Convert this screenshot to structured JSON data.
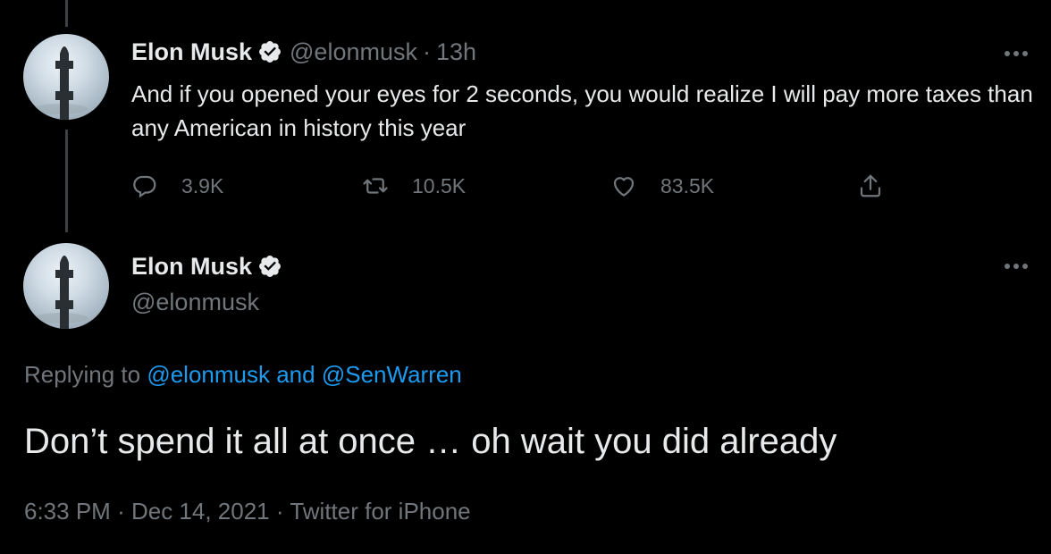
{
  "parent_tweet": {
    "display_name": "Elon Musk",
    "handle": "@elonmusk",
    "separator": "·",
    "time": "13h",
    "text": "And if you opened your eyes for 2 seconds, you would realize I will pay more taxes than any American in history this year",
    "actions": {
      "reply_count": "3.9K",
      "retweet_count": "10.5K",
      "like_count": "83.5K"
    },
    "icons": [
      "verified-badge-icon",
      "more-icon",
      "reply-icon",
      "retweet-icon",
      "like-icon",
      "share-icon"
    ]
  },
  "main_tweet": {
    "display_name": "Elon Musk",
    "handle": "@elonmusk",
    "replying_prefix": "Replying to",
    "replying_to_1": "@elonmusk",
    "replying_and": "and",
    "replying_to_2": "@SenWarren",
    "text": "Don’t spend it all at once … oh wait you did already",
    "time": "6:33 PM",
    "date": "Dec 14, 2021",
    "source": "Twitter for iPhone",
    "separator": "·"
  },
  "colors": {
    "background": "#000000",
    "primary_text": "#e7e9ea",
    "secondary_text": "#71767b",
    "link": "#1d9bf0",
    "thread_line": "#3e4144"
  }
}
